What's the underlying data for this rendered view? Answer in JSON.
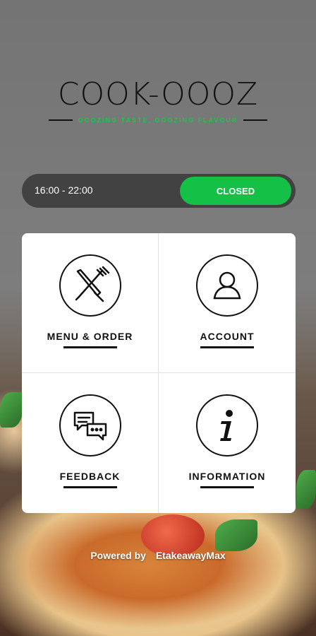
{
  "brand": {
    "name": "COOK-OOOZ",
    "tagline": "OOOZING TASTE, OOOZING FLAVOUR"
  },
  "hours": {
    "time_range": "16:00 - 22:00",
    "status": "CLOSED"
  },
  "menu": [
    {
      "label": "MENU & ORDER",
      "icon": "cutlery-icon"
    },
    {
      "label": "ACCOUNT",
      "icon": "user-icon"
    },
    {
      "label": "FEEDBACK",
      "icon": "chat-bubbles-icon"
    },
    {
      "label": "INFORMATION",
      "icon": "info-icon"
    }
  ],
  "footer": {
    "powered_by": "Powered by",
    "provider": "EtakeawayMax"
  },
  "colors": {
    "accent_green": "#15c047",
    "hours_bar": "#424242",
    "text_dark": "#111111"
  }
}
